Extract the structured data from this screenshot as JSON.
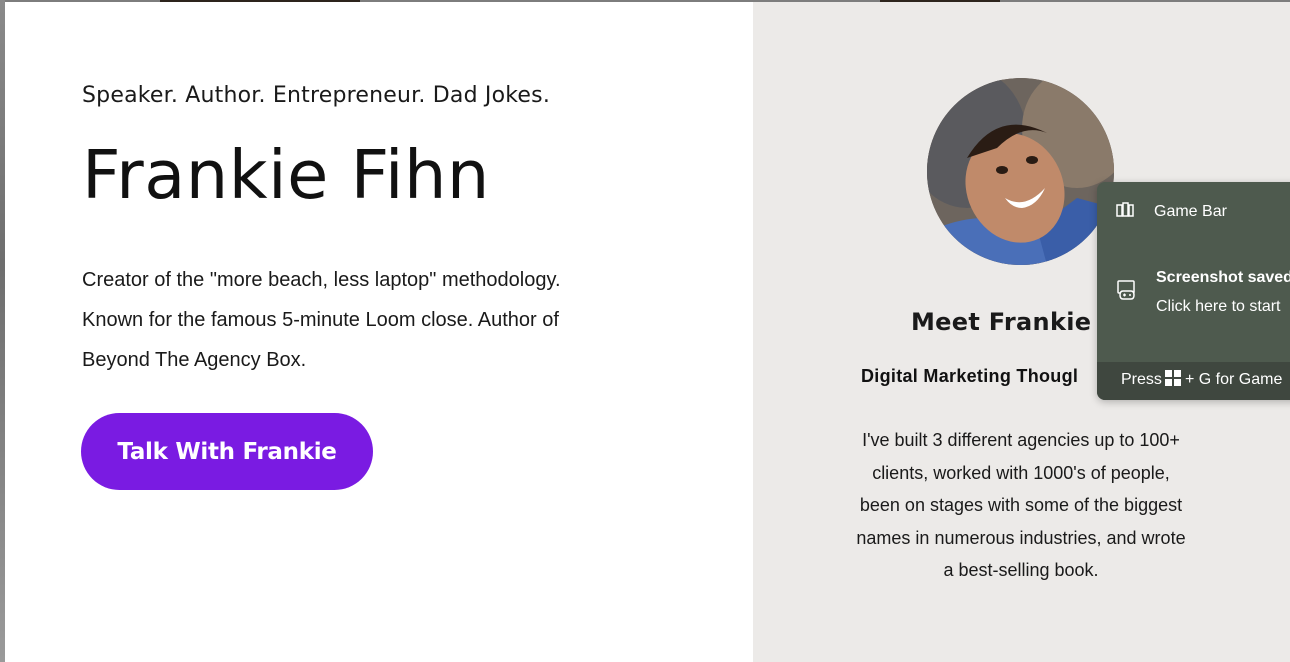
{
  "hero": {
    "tagline": "Speaker. Author. Entrepreneur. Dad Jokes.",
    "name": "Frankie Fihn",
    "description_lines": [
      "Creator of the \"more beach, less laptop\" methodology.",
      "Known for the famous 5-minute Loom close.  Author of",
      "Beyond The Agency Box."
    ],
    "cta_label": "Talk With Frankie"
  },
  "profile": {
    "meet_heading": "Meet Frankie F",
    "role": "Digital Marketing Thougl",
    "bio_lines": [
      "I've built 3 different agencies up to 100+",
      "clients, worked with 1000's of people,",
      "been on stages with some of the biggest",
      "names in numerous industries, and wrote",
      "a best-selling book."
    ]
  },
  "gamebar": {
    "title": "Game Bar",
    "toast_title": "Screenshot saved",
    "toast_text": "Click here to start",
    "footer_prefix": "Press",
    "footer_suffix": "+ G for Game"
  },
  "colors": {
    "cta_background": "#7a1be2",
    "right_panel_background": "#eceae8",
    "gamebar_background": "#4e5a4e"
  },
  "icons": {
    "gamebar_title": "gamebar-widgets-icon",
    "toast": "game-controller-icon",
    "footer_key": "windows-key-icon"
  }
}
